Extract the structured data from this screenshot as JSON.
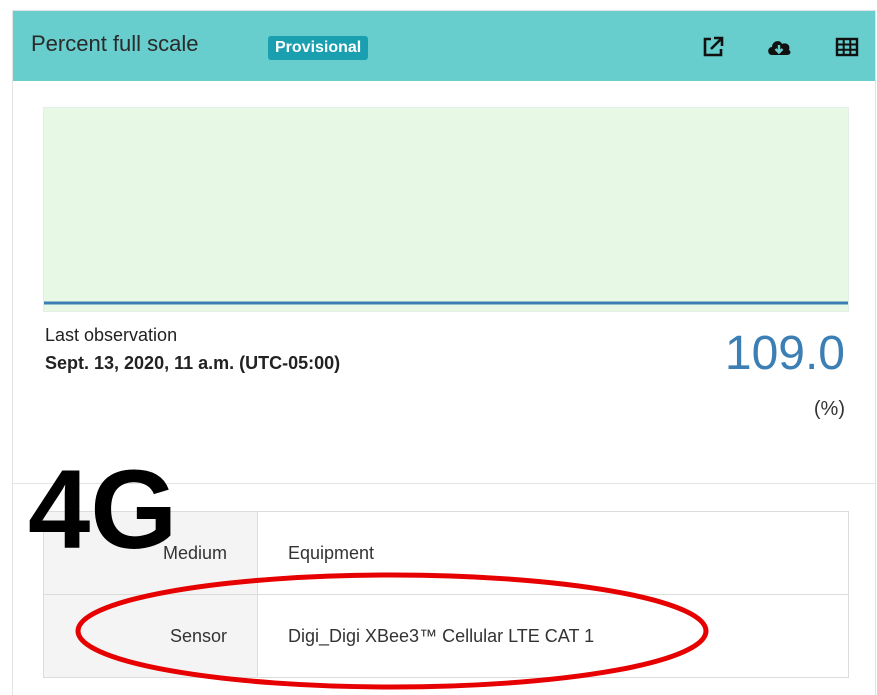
{
  "header": {
    "title": "Percent full scale",
    "badge": "Provisional",
    "icons": [
      "external-link-icon",
      "cloud-download-icon",
      "table-icon"
    ]
  },
  "colors": {
    "header_bg": "#67cdcd",
    "badge_bg": "#1a9fb0",
    "plot_bg": "#e7f9e4",
    "series_line": "#3c7fb5",
    "value_color": "#3c7fb5",
    "ellipse_color": "#e60000"
  },
  "chart_data": {
    "type": "line",
    "title": "",
    "xlabel": "",
    "ylabel": "",
    "note": "sparkline with no printed axes; flat series at the bottom",
    "series": [
      {
        "values": [
          0,
          0,
          0,
          0,
          0,
          0,
          0,
          0,
          0
        ]
      }
    ]
  },
  "observation": {
    "label": "Last observation",
    "date": "Sept. 13, 2020, 11 a.m. (UTC-05:00)",
    "value": "109.0",
    "unit": "(%)"
  },
  "metadata": [
    {
      "key": "Medium",
      "value": "Equipment"
    },
    {
      "key": "Sensor",
      "value": "Digi_Digi XBee3™ Cellular LTE CAT 1"
    }
  ],
  "overlay": {
    "text": "4G"
  }
}
